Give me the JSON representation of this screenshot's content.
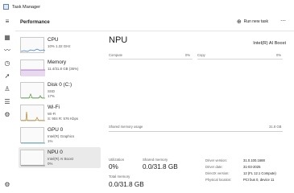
{
  "window": {
    "title": "Task Manager"
  },
  "header": {
    "section": "Performance",
    "run_task": "Run new task"
  },
  "perf_items": [
    {
      "name": "CPU",
      "line1": "10% 1.32 GHz",
      "line2": ""
    },
    {
      "name": "Memory",
      "line1": "11.4/31.8 GB (36%)",
      "line2": ""
    },
    {
      "name": "Disk 0 (C:)",
      "line1": "SSD",
      "line2": "17%"
    },
    {
      "name": "Wi-Fi",
      "line1": "Wi-Fi",
      "line2": "S: 904 R: 576 Kbps"
    },
    {
      "name": "GPU 0",
      "line1": "Intel(R) Graphics",
      "line2": "1%"
    },
    {
      "name": "NPU 0",
      "line1": "Intel(R) AI Boost",
      "line2": "0%"
    }
  ],
  "main": {
    "title": "NPU",
    "device": "Intel(R) AI Boost",
    "graph1_label": "Compute",
    "graph1_pct": "0%",
    "graph2_label": "Copy",
    "graph2_pct": "0%",
    "shared_mem_label": "Shared memory usage",
    "shared_mem_max": "31.8 GB",
    "utilization_label": "Utilization",
    "utilization_value": "0%",
    "shared_label": "Shared memory",
    "shared_value": "0.0/31.8 GB",
    "total_label": "Total memory",
    "total_value": "0.0/31.8 GB",
    "details": [
      {
        "key": "Driver version:",
        "value": "31.0.100.1688"
      },
      {
        "key": "Driver date:",
        "value": "31-03-2025"
      },
      {
        "key": "DirectX version:",
        "value": "12 (FL 12.1 Compute)"
      },
      {
        "key": "Physical location:",
        "value": "PCI bus 0, device 11"
      }
    ]
  },
  "colors": {
    "accent": "#0a64c8",
    "cpu": "#3a7fd0",
    "memory": "#9a4fb8",
    "disk": "#4f9a3a",
    "wifi": "#b5872a",
    "gpu": "#2f8fb0",
    "npu": "#6c6c6c"
  }
}
